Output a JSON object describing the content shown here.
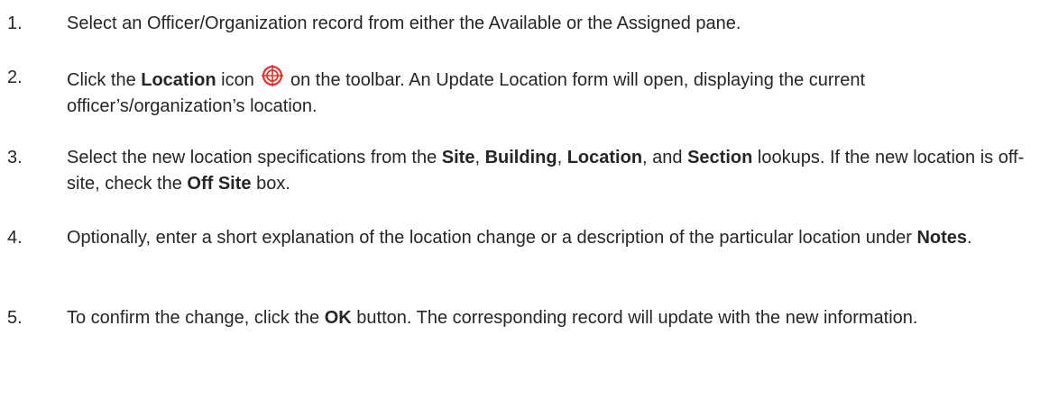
{
  "steps": [
    {
      "number": "1.",
      "parts": {
        "t1": "Select an Officer/Organization record from either the Available or the Assigned pane."
      }
    },
    {
      "number": "2.",
      "parts": {
        "t1": "Click the ",
        "b1": "Location",
        "t2": " icon ",
        "t3": " on the toolbar. An Update Location form will open, displaying the current officer’s/organization’s location."
      },
      "icon": "location-target-icon",
      "icon_color": "#e8332a"
    },
    {
      "number": "3.",
      "parts": {
        "t1": "Select the new location specifications from the ",
        "b1": "Site",
        "t2": ", ",
        "b2": "Building",
        "t3": ", ",
        "b3": "Location",
        "t4": ", and ",
        "b4": "Section",
        "t5": " lookups. If the new location is off-site, check the ",
        "b5": "Off Site",
        "t6": " box."
      }
    },
    {
      "number": "4.",
      "parts": {
        "t1": "Optionally, enter a short explanation of the location change or a description of the particular location under ",
        "b1": "Notes",
        "t2": "."
      }
    },
    {
      "number": "5.",
      "parts": {
        "t1": "To confirm the change, click the ",
        "b1": "OK",
        "t2": " button. The corresponding record will update with the new information."
      }
    }
  ]
}
